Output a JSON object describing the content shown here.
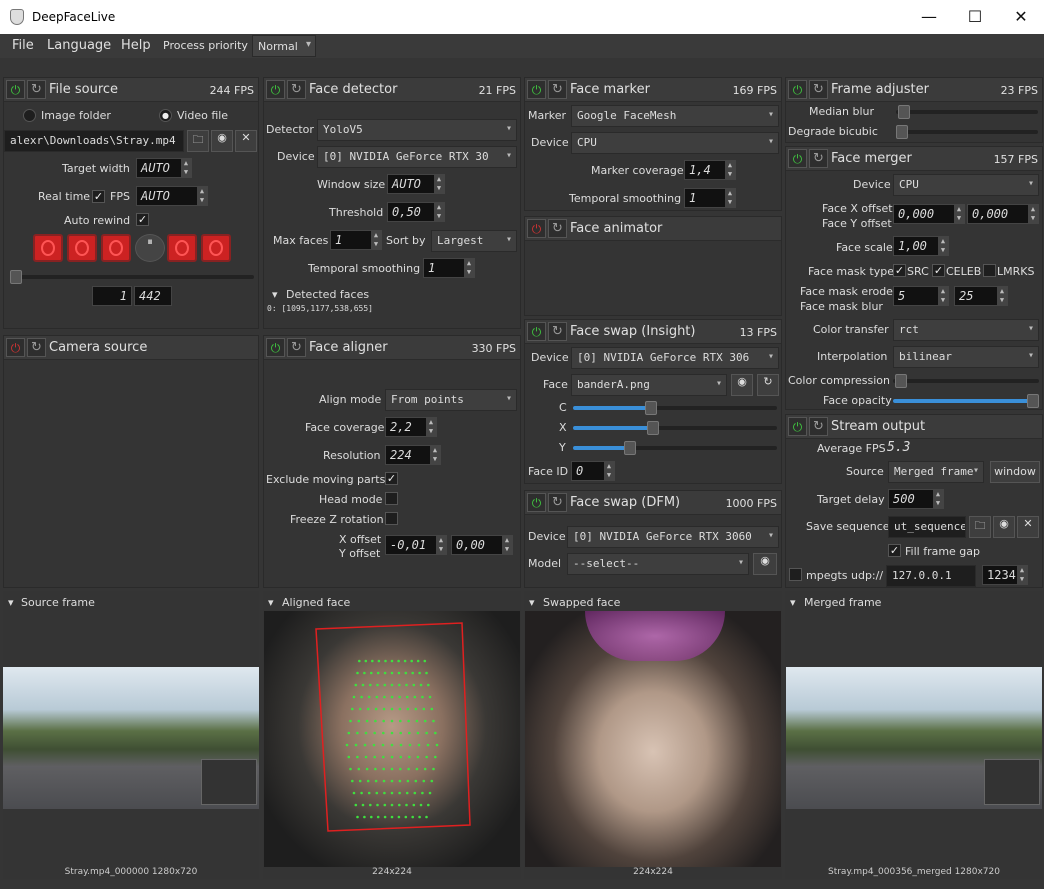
{
  "window": {
    "title": "DeepFaceLive",
    "minimize": "—",
    "maximize": "☐",
    "close": "✕"
  },
  "menu": {
    "file": "File",
    "language": "Language",
    "help": "Help",
    "priority_label": "Process priority",
    "priority_value": "Normal"
  },
  "file_source": {
    "title": "File source",
    "fps": "244 FPS",
    "image_folder": "Image folder",
    "video_file": "Video file",
    "path": "alexr\\Downloads\\Stray.mp4",
    "target_width_label": "Target width",
    "target_width": "AUTO",
    "real_time_label": "Real time",
    "fps_label": "FPS",
    "fps_value": "AUTO",
    "auto_rewind_label": "Auto rewind",
    "frame_current": "1",
    "frame_total": "442"
  },
  "camera_source": {
    "title": "Camera source"
  },
  "face_detector": {
    "title": "Face detector",
    "fps": "21 FPS",
    "detector_label": "Detector",
    "detector": "YoloV5",
    "device_label": "Device",
    "device": "[0] NVIDIA GeForce RTX 30",
    "window_size_label": "Window size",
    "window_size": "AUTO",
    "threshold_label": "Threshold",
    "threshold": "0,50",
    "max_faces_label": "Max faces",
    "max_faces": "1",
    "sort_by_label": "Sort by",
    "sort_by": "Largest",
    "temporal_label": "Temporal smoothing",
    "temporal": "1",
    "detected_faces_label": "Detected faces",
    "detected_faces": "0: [1095,1177,538,655]"
  },
  "face_aligner": {
    "title": "Face aligner",
    "fps": "330 FPS",
    "align_mode_label": "Align mode",
    "align_mode": "From points",
    "face_coverage_label": "Face coverage",
    "face_coverage": "2,2",
    "resolution_label": "Resolution",
    "resolution": "224",
    "exclude_label": "Exclude moving parts",
    "head_mode_label": "Head mode",
    "freeze_z_label": "Freeze Z rotation",
    "x_offset_label": "X offset",
    "y_offset_label": "Y offset",
    "x_offset": "-0,01",
    "y_offset": "0,00"
  },
  "face_marker": {
    "title": "Face marker",
    "fps": "169 FPS",
    "marker_label": "Marker",
    "marker": "Google FaceMesh",
    "device_label": "Device",
    "device": "CPU",
    "coverage_label": "Marker coverage",
    "coverage": "1,4",
    "temporal_label": "Temporal smoothing",
    "temporal": "1"
  },
  "face_animator": {
    "title": "Face animator"
  },
  "face_swap_insight": {
    "title": "Face swap (Insight)",
    "fps": "13 FPS",
    "device_label": "Device",
    "device": "[0] NVIDIA GeForce RTX 306",
    "face_label": "Face",
    "face": "banderA.png",
    "c_label": "C",
    "x_label": "X",
    "y_label": "Y",
    "c_value": 0.38,
    "x_value": 0.39,
    "y_value": 0.28,
    "face_id_label": "Face ID",
    "face_id": "0"
  },
  "face_swap_dfm": {
    "title": "Face swap (DFM)",
    "fps": "1000 FPS",
    "device_label": "Device",
    "device": "[0] NVIDIA GeForce RTX 3060",
    "model_label": "Model",
    "model": "--select--"
  },
  "frame_adjuster": {
    "title": "Frame adjuster",
    "fps": "23 FPS",
    "median_blur_label": "Median blur",
    "degrade_label": "Degrade bicubic"
  },
  "face_merger": {
    "title": "Face merger",
    "fps": "157 FPS",
    "device_label": "Device",
    "device": "CPU",
    "face_x_label": "Face X offset",
    "face_y_label": "Face Y offset",
    "face_x": "0,000",
    "face_y": "0,000",
    "face_scale_label": "Face scale",
    "face_scale": "1,00",
    "mask_type_label": "Face mask type",
    "src": "SRC",
    "celeb": "CELEB",
    "lmrks": "LMRKS",
    "erode_label": "Face mask erode",
    "blur_label": "Face mask blur",
    "erode": "5",
    "blur": "25",
    "color_transfer_label": "Color transfer",
    "color_transfer": "rct",
    "interp_label": "Interpolation",
    "interp": "bilinear",
    "color_comp_label": "Color compression",
    "opacity_label": "Face opacity",
    "opacity_value": 1.0
  },
  "stream_output": {
    "title": "Stream output",
    "avg_fps_label": "Average FPS",
    "avg_fps": "5.3",
    "source_label": "Source",
    "source": "Merged frame",
    "window_btn": "window",
    "target_delay_label": "Target delay",
    "target_delay": "500",
    "save_seq_label": "Save sequence",
    "save_seq": "ut_sequence",
    "fill_gap_label": "Fill frame gap",
    "mpegts_label": "mpegts udp://",
    "ip": "127.0.0.1",
    "port": "1234"
  },
  "frames": {
    "source": "Source frame",
    "aligned": "Aligned face",
    "swapped": "Swapped face",
    "merged": "Merged frame",
    "source_cap": "Stray.mp4_000000 1280x720",
    "aligned_cap": "224x224",
    "swapped_cap": "224x224",
    "merged_cap": "Stray.mp4_000356_merged 1280x720"
  }
}
